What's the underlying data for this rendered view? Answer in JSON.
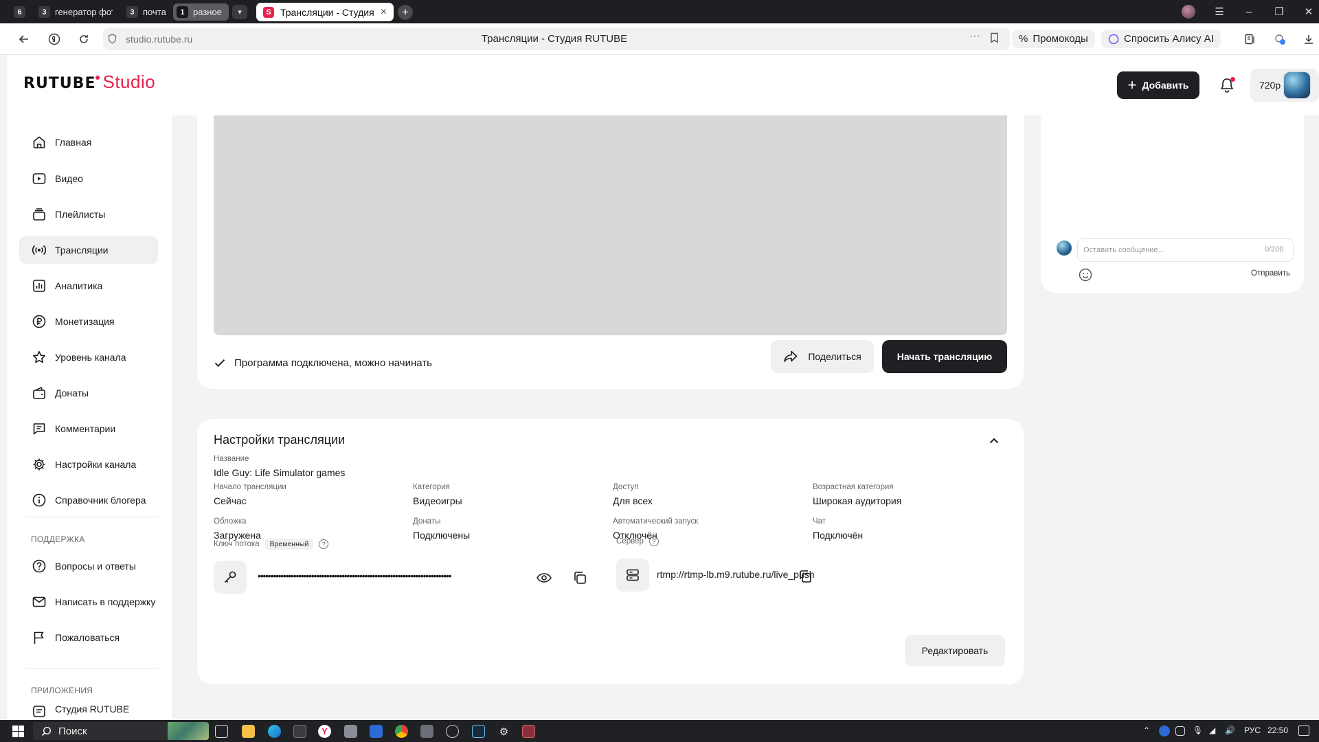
{
  "browser": {
    "tab_groups": [
      {
        "count": "6",
        "label": ""
      },
      {
        "count": "3",
        "label": "генератор фото"
      },
      {
        "count": "3",
        "label": "почта"
      },
      {
        "count": "1",
        "label": "разное"
      }
    ],
    "active_tab_title": "Трансляции - Студия R",
    "url": "studio.rutube.ru",
    "page_title": "Трансляции - Студия RUTUBE",
    "promo_label": "Промокоды",
    "alice_label": "Спросить Алису AI"
  },
  "header": {
    "logo_main": "RUTUBE",
    "logo_sub": "Studio",
    "add_label": "Добавить",
    "quality": "720p"
  },
  "sidebar": {
    "items": [
      {
        "label": "Главная",
        "icon": "home-icon"
      },
      {
        "label": "Видео",
        "icon": "video-icon"
      },
      {
        "label": "Плейлисты",
        "icon": "playlist-icon"
      },
      {
        "label": "Трансляции",
        "icon": "broadcast-icon"
      },
      {
        "label": "Аналитика",
        "icon": "analytics-icon"
      },
      {
        "label": "Монетизация",
        "icon": "ruble-icon"
      },
      {
        "label": "Уровень канала",
        "icon": "star-icon"
      },
      {
        "label": "Донаты",
        "icon": "wallet-icon"
      },
      {
        "label": "Комментарии",
        "icon": "comment-icon"
      },
      {
        "label": "Настройки канала",
        "icon": "gear-icon"
      },
      {
        "label": "Справочник блогера",
        "icon": "info-icon"
      }
    ],
    "support_heading": "ПОДДЕРЖКА",
    "support_items": [
      {
        "label": "Вопросы и ответы",
        "icon": "question-icon"
      },
      {
        "label": "Написать в поддержку",
        "icon": "mail-icon"
      },
      {
        "label": "Пожаловаться",
        "icon": "flag-icon"
      }
    ],
    "apps_heading": "ПРИЛОЖЕНИЯ",
    "apps_items": [
      {
        "label": "Студия RUTUBE",
        "icon": "app-icon"
      }
    ]
  },
  "stream": {
    "status": "Программа подключена, можно начинать",
    "share_label": "Поделиться",
    "start_label": "Начать трансляцию"
  },
  "settings": {
    "title": "Настройки трансляции",
    "name_label": "Название",
    "name_value": "Idle Guy: Life Simulator games",
    "fields": [
      {
        "label": "Начало трансляции",
        "value": "Сейчас"
      },
      {
        "label": "Категория",
        "value": "Видеоигры"
      },
      {
        "label": "Доступ",
        "value": "Для всех"
      },
      {
        "label": "Возрастная категория",
        "value": "Широкая аудитория"
      },
      {
        "label": "Обложка",
        "value": "Загружена"
      },
      {
        "label": "Донаты",
        "value": "Подключены"
      },
      {
        "label": "Автоматический запуск",
        "value": "Отключён"
      },
      {
        "label": "Чат",
        "value": "Подключён"
      }
    ],
    "key_label": "Ключ потока",
    "key_badge": "Временный",
    "key_masked": "••••••••••••••••••••••••••••••••••••••••••••••••••••••••••••••••••••••••••••",
    "server_label": "Сервер",
    "server_url": "rtmp://rtmp-lb.m9.rutube.ru/live_push",
    "edit_label": "Редактировать"
  },
  "chat": {
    "placeholder": "Оставить сообщение...",
    "counter": "0/200",
    "send_label": "Отправить"
  },
  "taskbar": {
    "search_label": "Поиск",
    "lang": "РУС",
    "time": "22:50"
  },
  "colors": {
    "brand": "#e8214d",
    "dark_button": "#1f2023",
    "light_button": "#eff0f2"
  }
}
